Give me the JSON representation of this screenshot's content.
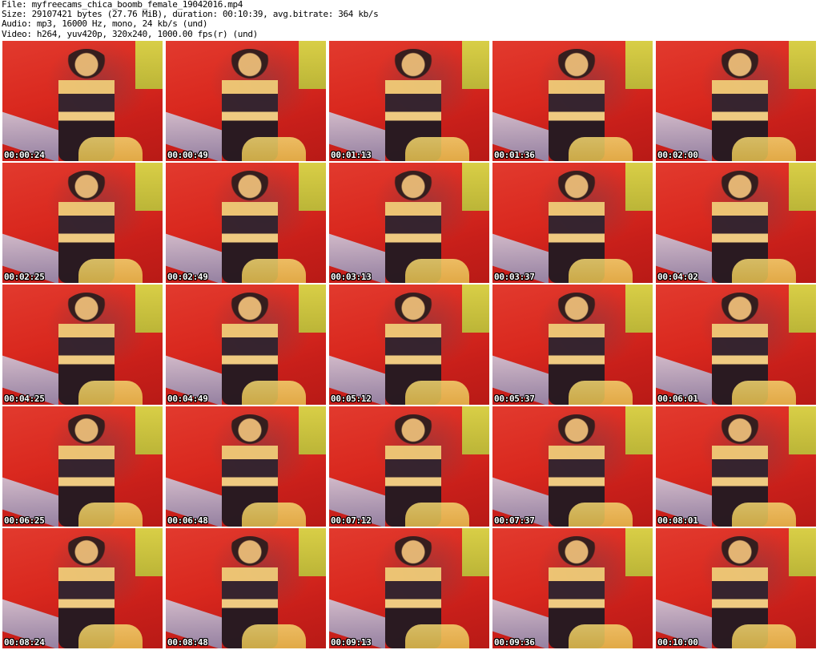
{
  "header": {
    "file_line": "File: myfreecams_chica_boomb_female_19042016.mp4",
    "size_line": "Size: 29107421 bytes (27.76 MiB), duration: 00:10:39, avg.bitrate: 364 kb/s",
    "audio_line": "Audio: mp3, 16000 Hz, mono, 24 kb/s (und)",
    "video_line": "Video: h264, yuv420p, 320x240, 1000.00 fps(r) (und)"
  },
  "thumbnails": [
    {
      "timestamp": "00:00:24"
    },
    {
      "timestamp": "00:00:49"
    },
    {
      "timestamp": "00:01:13"
    },
    {
      "timestamp": "00:01:36"
    },
    {
      "timestamp": "00:02:00"
    },
    {
      "timestamp": "00:02:25"
    },
    {
      "timestamp": "00:02:49"
    },
    {
      "timestamp": "00:03:13"
    },
    {
      "timestamp": "00:03:37"
    },
    {
      "timestamp": "00:04:02"
    },
    {
      "timestamp": "00:04:25"
    },
    {
      "timestamp": "00:04:49"
    },
    {
      "timestamp": "00:05:12"
    },
    {
      "timestamp": "00:05:37"
    },
    {
      "timestamp": "00:06:01"
    },
    {
      "timestamp": "00:06:25"
    },
    {
      "timestamp": "00:06:48"
    },
    {
      "timestamp": "00:07:12"
    },
    {
      "timestamp": "00:07:37"
    },
    {
      "timestamp": "00:08:01"
    },
    {
      "timestamp": "00:08:24"
    },
    {
      "timestamp": "00:08:48"
    },
    {
      "timestamp": "00:09:13"
    },
    {
      "timestamp": "00:09:36"
    },
    {
      "timestamp": "00:10:00"
    }
  ]
}
